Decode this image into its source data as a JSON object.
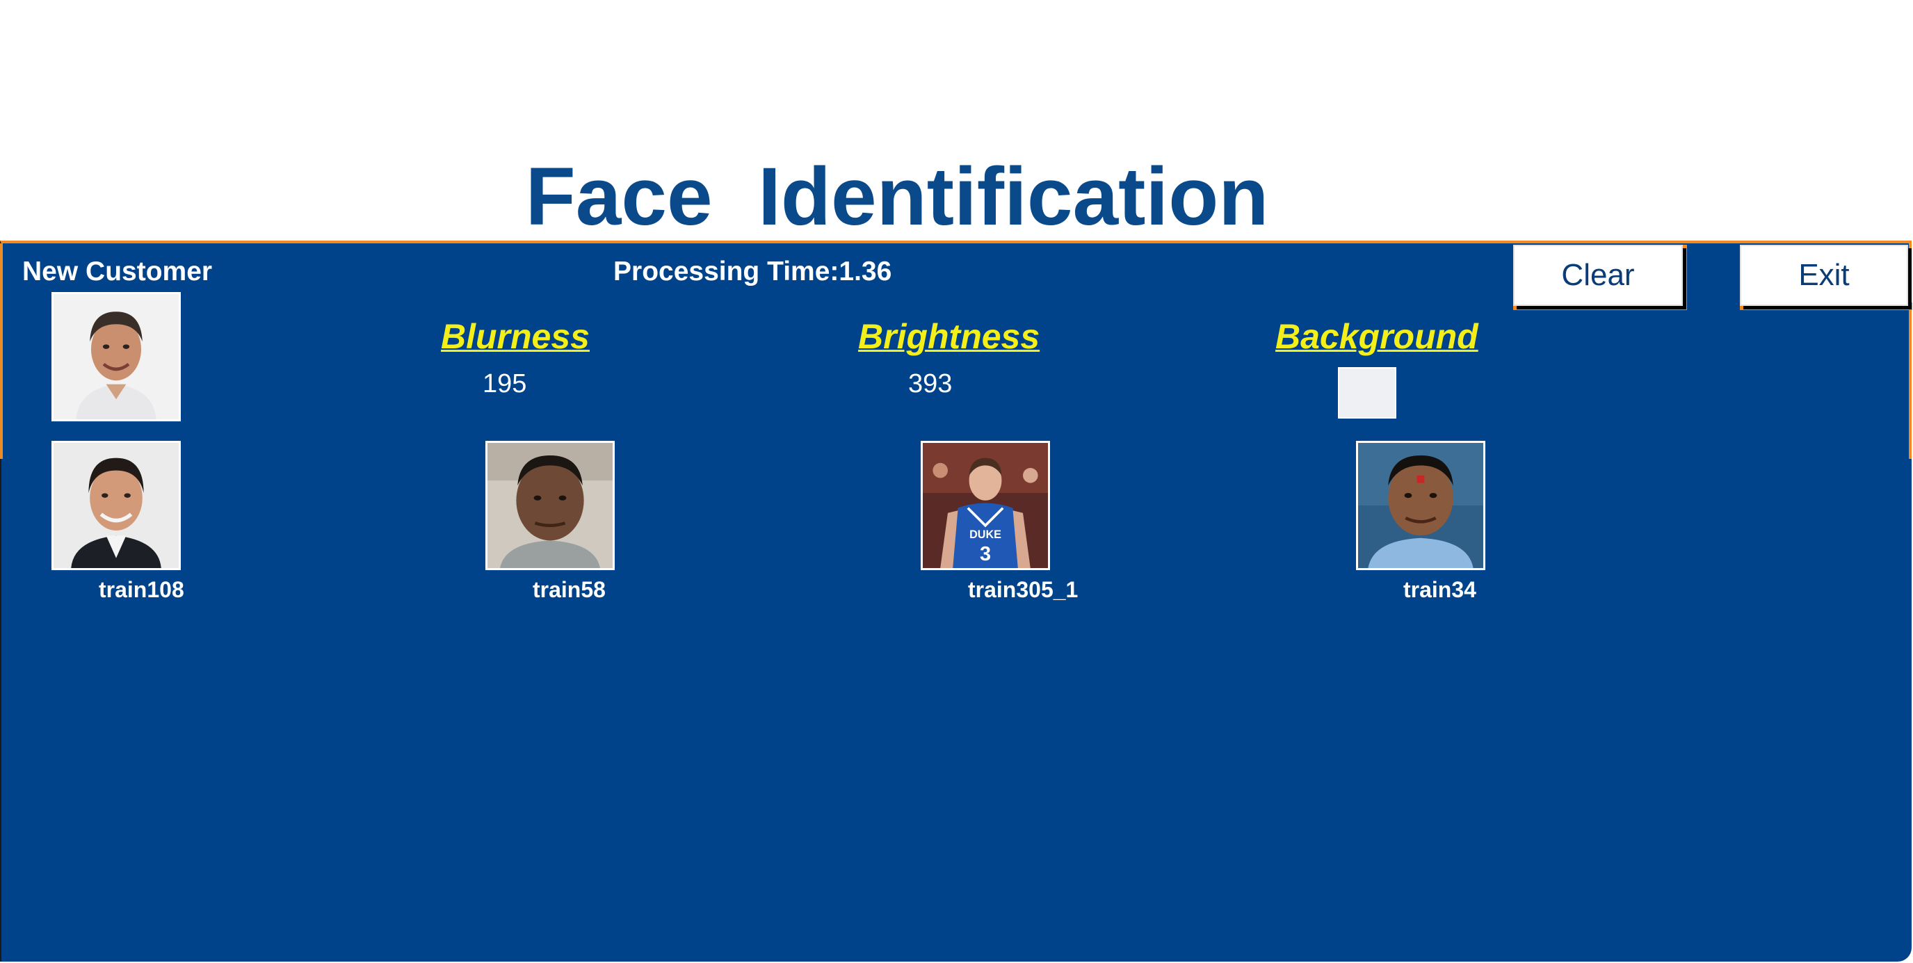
{
  "header": {
    "title": "Face  Identification"
  },
  "customer": {
    "label": "New Customer",
    "processing_time": "Processing Time:1.36"
  },
  "buttons": {
    "clear_label": "Clear",
    "exit_label": "Exit"
  },
  "metrics": {
    "blurness": {
      "label": "Blurness",
      "value": "195"
    },
    "brightness": {
      "label": "Brightness",
      "value": "393"
    },
    "background": {
      "label": "Background",
      "swatch_color": "#eff0f4"
    }
  },
  "matches": [
    {
      "name": "train108"
    },
    {
      "name": "train58"
    },
    {
      "name": "train305_1"
    },
    {
      "name": "train34"
    }
  ],
  "colors": {
    "title": "#0a4a8a",
    "panel": "#00438a",
    "accent": "#f08a24",
    "heading": "#f4ef19",
    "text": "#ffffff"
  }
}
